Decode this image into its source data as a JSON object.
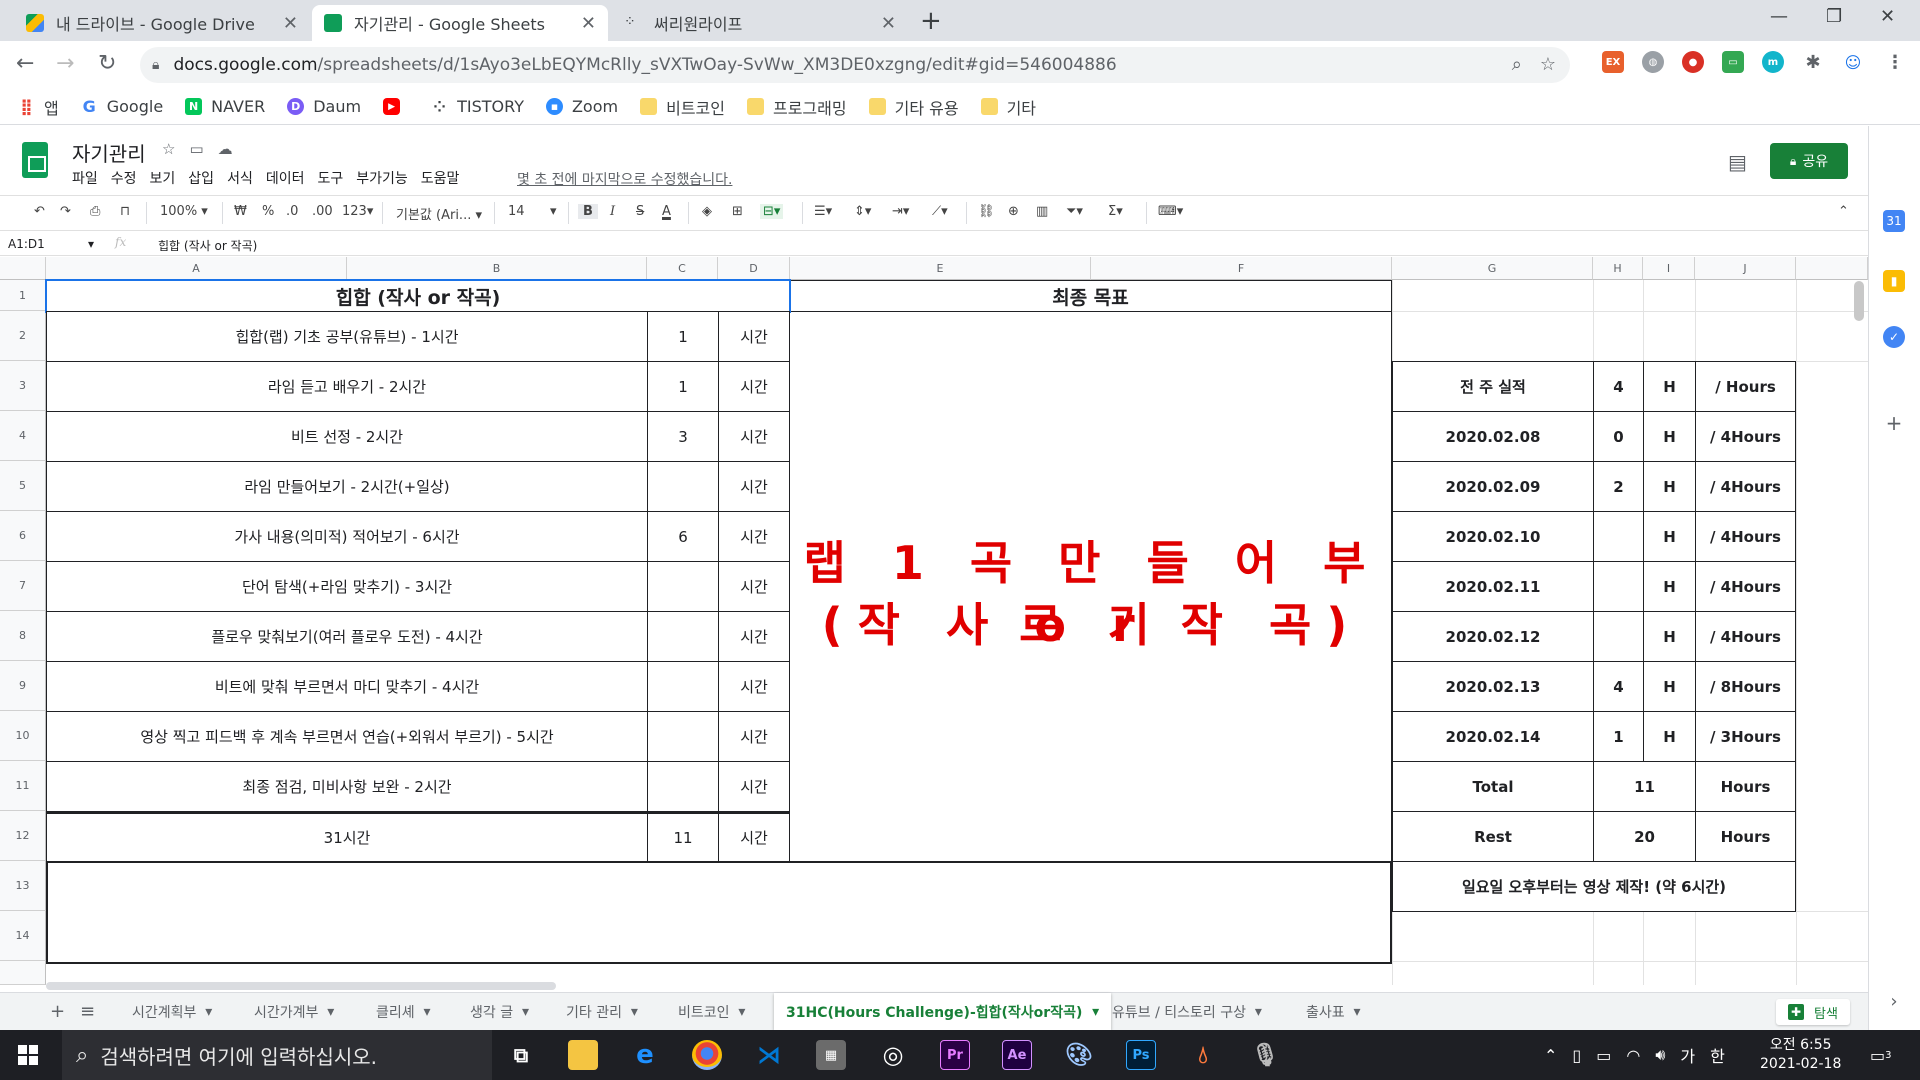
{
  "browser": {
    "tabs": [
      {
        "title": "내 드라이브 - Google Drive",
        "icon": "google-drive-icon",
        "active": false
      },
      {
        "title": "자기관리 - Google Sheets",
        "icon": "google-sheets-icon",
        "active": true
      },
      {
        "title": "써리원라이프",
        "icon": "tistory-icon",
        "active": false
      }
    ],
    "url_host": "docs.google.com",
    "url_path": "/spreadsheets/d/1sAyo3eLbEQYMcRlly_sVXTwOay-SvWw_XM3DE0xzgng/edit#gid=546004886",
    "bookmarks": [
      "앱",
      "Google",
      "NAVER",
      "Daum",
      "",
      "TISTORY",
      "Zoom",
      "비트코인",
      "프로그래밍",
      "기타 유용",
      "기타"
    ]
  },
  "sheets": {
    "doc_title": "자기관리",
    "menus": [
      "파일",
      "수정",
      "보기",
      "삽입",
      "서식",
      "데이터",
      "도구",
      "부가기능",
      "도움말"
    ],
    "last_edit": "몇 초 전에 마지막으로 수정했습니다.",
    "share_label": "공유",
    "toolbar": {
      "zoom": "100%",
      "percent": "%",
      "dec_decrease": ".0",
      "dec_increase": ".00",
      "format_more": "123",
      "font": "기본값 (Ari...",
      "font_size": "14"
    },
    "name_box": "A1:D1",
    "formula_content": "힙합 (작사 or 작곡)",
    "columns": [
      "A",
      "B",
      "C",
      "D",
      "E",
      "F",
      "G",
      "H",
      "I",
      "J"
    ],
    "rows": [
      "1",
      "2",
      "3",
      "4",
      "5",
      "6",
      "7",
      "8",
      "9",
      "10",
      "11",
      "12",
      "13",
      "14"
    ]
  },
  "plan": {
    "header": "힙합 (작사 or 작곡)",
    "tasks": [
      {
        "task": "힙합(랩) 기초 공부(유튜브) - 1시간",
        "done": "1",
        "unit": "시간"
      },
      {
        "task": "라임 듣고 배우기 - 2시간",
        "done": "1",
        "unit": "시간"
      },
      {
        "task": "비트 선정 - 2시간",
        "done": "3",
        "unit": "시간"
      },
      {
        "task": "라임 만들어보기 - 2시간(+일상)",
        "done": "",
        "unit": "시간"
      },
      {
        "task": "가사 내용(의미적) 적어보기 - 6시간",
        "done": "6",
        "unit": "시간"
      },
      {
        "task": "단어 탐색(+라임 맞추기) - 3시간",
        "done": "",
        "unit": "시간"
      },
      {
        "task": "플로우 맞춰보기(여러 플로우 도전) - 4시간",
        "done": "",
        "unit": "시간"
      },
      {
        "task": "비트에 맞춰 부르면서 마디 맞추기 - 4시간",
        "done": "",
        "unit": "시간"
      },
      {
        "task": "영상 찍고 피드백 후 계속 부르면서 연습(+외워서 부르기) - 5시간",
        "done": "",
        "unit": "시간"
      },
      {
        "task": "최종 점검, 미비사항 보완 - 2시간",
        "done": "",
        "unit": "시간"
      }
    ],
    "total_label": "31시간",
    "total_done": "11",
    "total_unit": "시간"
  },
  "goal": {
    "header": "최종 목표",
    "line1": "랩 1 곡 만 들 어 부 르 기",
    "line2": "(작 사 o r 작 곡)"
  },
  "log": {
    "rows": [
      {
        "label": "전 주 실적",
        "value": "4",
        "unit": "H",
        "target": "/ Hours"
      },
      {
        "label": "2020.02.08",
        "value": "0",
        "unit": "H",
        "target": "/ 4Hours"
      },
      {
        "label": "2020.02.09",
        "value": "2",
        "unit": "H",
        "target": "/ 4Hours"
      },
      {
        "label": "2020.02.10",
        "value": "",
        "unit": "H",
        "target": "/ 4Hours"
      },
      {
        "label": "2020.02.11",
        "value": "",
        "unit": "H",
        "target": "/ 4Hours"
      },
      {
        "label": "2020.02.12",
        "value": "",
        "unit": "H",
        "target": "/ 4Hours"
      },
      {
        "label": "2020.02.13",
        "value": "4",
        "unit": "H",
        "target": "/ 8Hours"
      },
      {
        "label": "2020.02.14",
        "value": "1",
        "unit": "H",
        "target": "/ 3Hours"
      }
    ],
    "total": {
      "label": "Total",
      "value": "11",
      "unit": "Hours"
    },
    "rest": {
      "label": "Rest",
      "value": "20",
      "unit": "Hours"
    },
    "note": "일요일 오후부터는 영상 제작! (약 6시간)"
  },
  "sheet_tabs": [
    "시간계획부",
    "시간가계부",
    "클리셰",
    "생각 글",
    "기타 관리",
    "비트코인",
    "31HC(Hours Challenge)-힙합(작사or작곡)",
    "유튜브 / 티스토리 구상",
    "출사표"
  ],
  "explore_label": "탐색",
  "taskbar": {
    "search_placeholder": "검색하려면 여기에 입력하십시오.",
    "ime": "가",
    "ime2": "한",
    "time": "오전 6:55",
    "date": "2021-02-18",
    "notifications": "3"
  },
  "colors": {
    "accent_green": "#188038",
    "goal_red": "#e00000",
    "selection_blue": "#1a73e8"
  }
}
